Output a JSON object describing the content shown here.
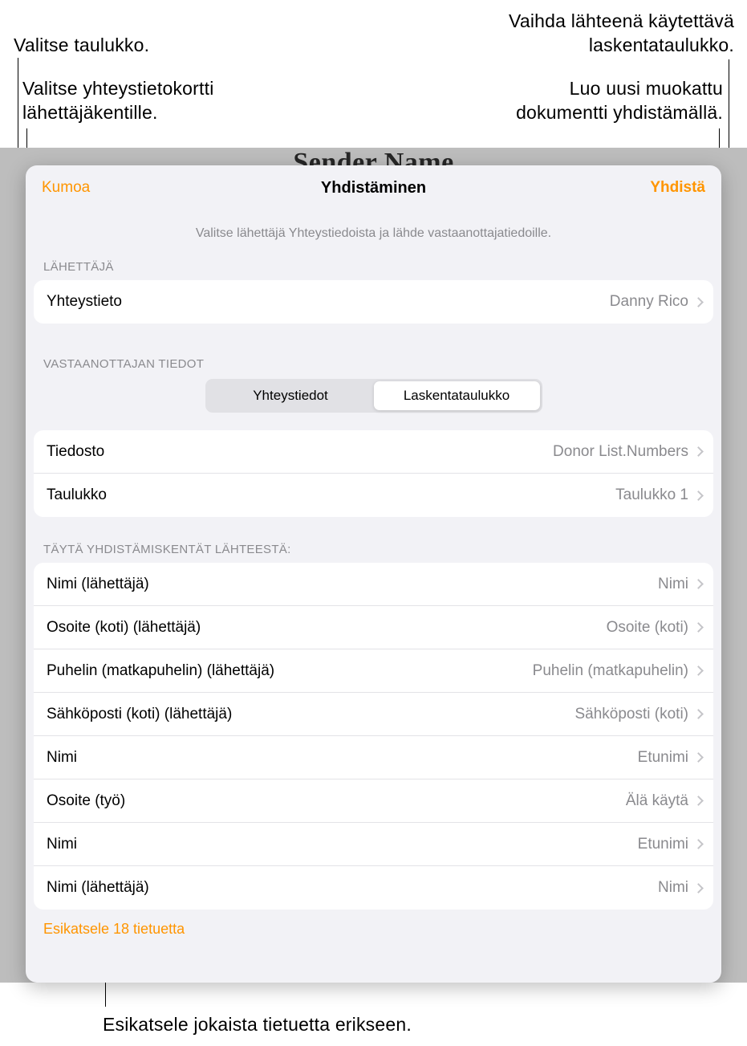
{
  "callouts": {
    "top_left_1": "Valitse taulukko.",
    "top_left_2a": "Valitse yhteystietokortti",
    "top_left_2b": "lähettäjäkentille.",
    "top_right_1a": "Vaihda lähteenä käytettävä",
    "top_right_1b": "laskentataulukko.",
    "top_right_2a": "Luo uusi muokattu",
    "top_right_2b": "dokumentti yhdistämällä.",
    "bottom": "Esikatsele jokaista tietuetta erikseen."
  },
  "background_title": "Sender Name",
  "sheet": {
    "cancel": "Kumoa",
    "title": "Yhdistäminen",
    "merge": "Yhdistä",
    "subtitle": "Valitse lähettäjä Yhteystiedoista ja lähde vastaanottajatiedoille.",
    "sender_section": "LÄHETTÄJÄ",
    "contact_label": "Yhteystieto",
    "contact_value": "Danny Rico",
    "recipient_section": "VASTAANOTTAJAN TIEDOT",
    "segmented": {
      "contacts": "Yhteystiedot",
      "spreadsheet": "Laskentataulukko"
    },
    "file_label": "Tiedosto",
    "file_value": "Donor List.Numbers",
    "table_label": "Taulukko",
    "table_value": "Taulukko 1",
    "fields_section": "TÄYTÄ YHDISTÄMISKENTÄT LÄHTEESTÄ:",
    "fields": [
      {
        "label": "Nimi (lähettäjä)",
        "value": "Nimi"
      },
      {
        "label": "Osoite (koti) (lähettäjä)",
        "value": "Osoite (koti)"
      },
      {
        "label": "Puhelin (matkapuhelin) (lähettäjä)",
        "value": "Puhelin (matkapuhelin)"
      },
      {
        "label": "Sähköposti (koti) (lähettäjä)",
        "value": "Sähköposti (koti)"
      },
      {
        "label": "Nimi",
        "value": "Etunimi"
      },
      {
        "label": "Osoite (työ)",
        "value": "Älä käytä"
      },
      {
        "label": "Nimi",
        "value": "Etunimi"
      },
      {
        "label": "Nimi (lähettäjä)",
        "value": "Nimi"
      }
    ],
    "preview": "Esikatsele 18 tietuetta"
  }
}
